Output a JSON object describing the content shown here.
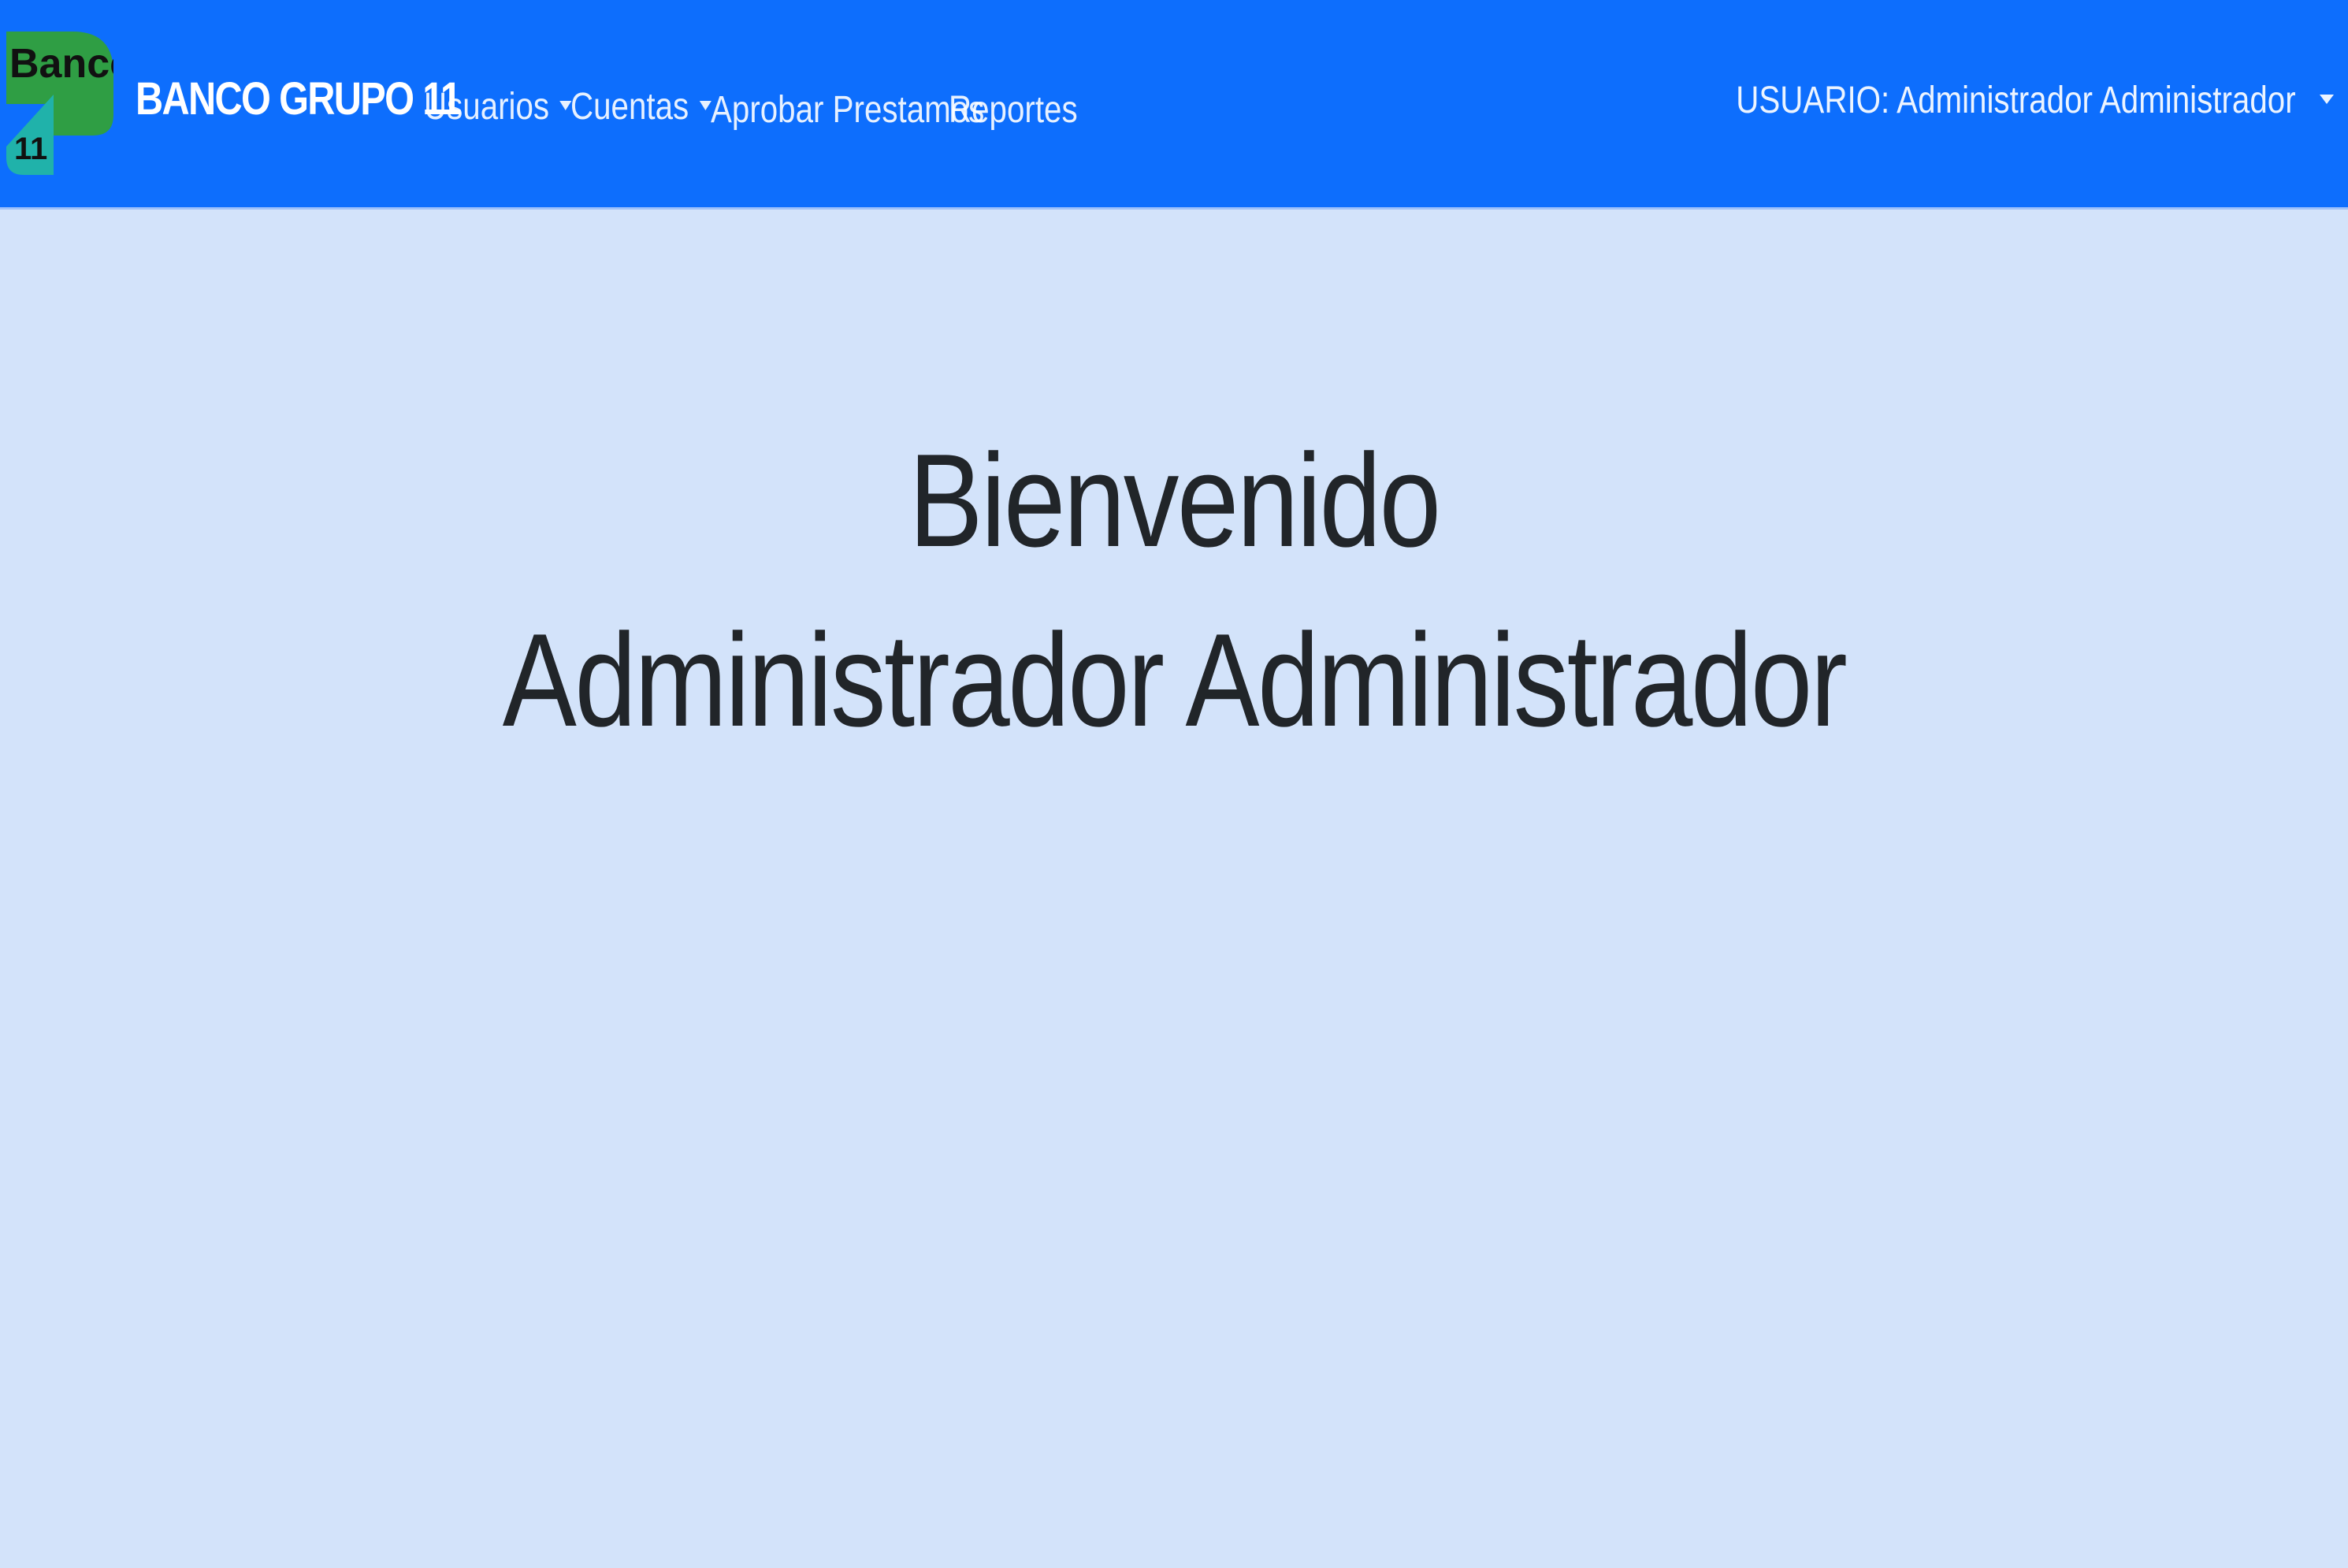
{
  "navbar": {
    "logo": {
      "top_text": "Banco",
      "bottom_text": "11",
      "colors": {
        "green": "#2f9e44",
        "teal": "#20b2aa"
      }
    },
    "brand": "BANCO GRUPO 11",
    "items": [
      {
        "label": "Usuarios",
        "has_dropdown": true
      },
      {
        "label": "Cuentas",
        "has_dropdown": true
      },
      {
        "label": "Aprobar Prestamos",
        "has_dropdown": false
      },
      {
        "label": "Reportes",
        "has_dropdown": false
      }
    ],
    "user_menu": {
      "label": "USUARIO: Administrador Administrador",
      "has_dropdown": true
    },
    "colors": {
      "background": "#0d6efd",
      "text": "#ffffff"
    }
  },
  "main": {
    "greeting": "Bienvenido",
    "user_name": "Administrador Administrador",
    "colors": {
      "background": "#d3e3fa",
      "text": "#212529"
    }
  }
}
